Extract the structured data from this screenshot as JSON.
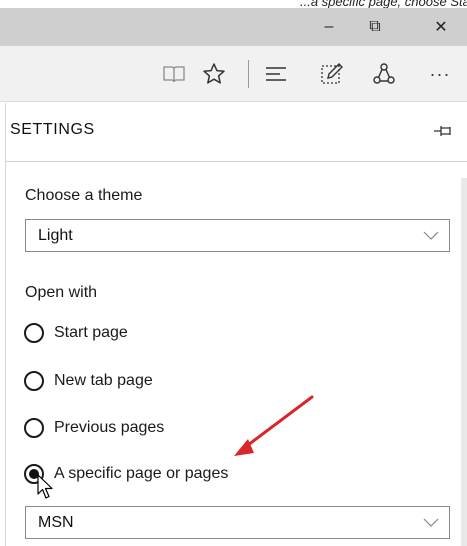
{
  "top_strip": {
    "text": "...a specific page, choose Start page"
  },
  "window_controls": {
    "minimize": "–",
    "maximize": "⧉",
    "close": "✕"
  },
  "toolbar": {
    "icons": [
      "reading-view-icon",
      "star-icon",
      "hub-icon",
      "web-note-icon",
      "share-icon",
      "more-icon"
    ],
    "more_label": "···"
  },
  "panel": {
    "title": "SETTINGS",
    "theme": {
      "label": "Choose a theme",
      "selected": "Light"
    },
    "open_with": {
      "label": "Open with",
      "options": [
        {
          "label": "Start page",
          "checked": false
        },
        {
          "label": "New tab page",
          "checked": false
        },
        {
          "label": "Previous pages",
          "checked": false
        },
        {
          "label": "A specific page or pages",
          "checked": true
        }
      ]
    },
    "specific_page": {
      "selected": "MSN"
    }
  },
  "colors": {
    "arrow": "#d9262b",
    "titlebar": "#cfcfcf",
    "toolbar": "#f1f1f1"
  }
}
